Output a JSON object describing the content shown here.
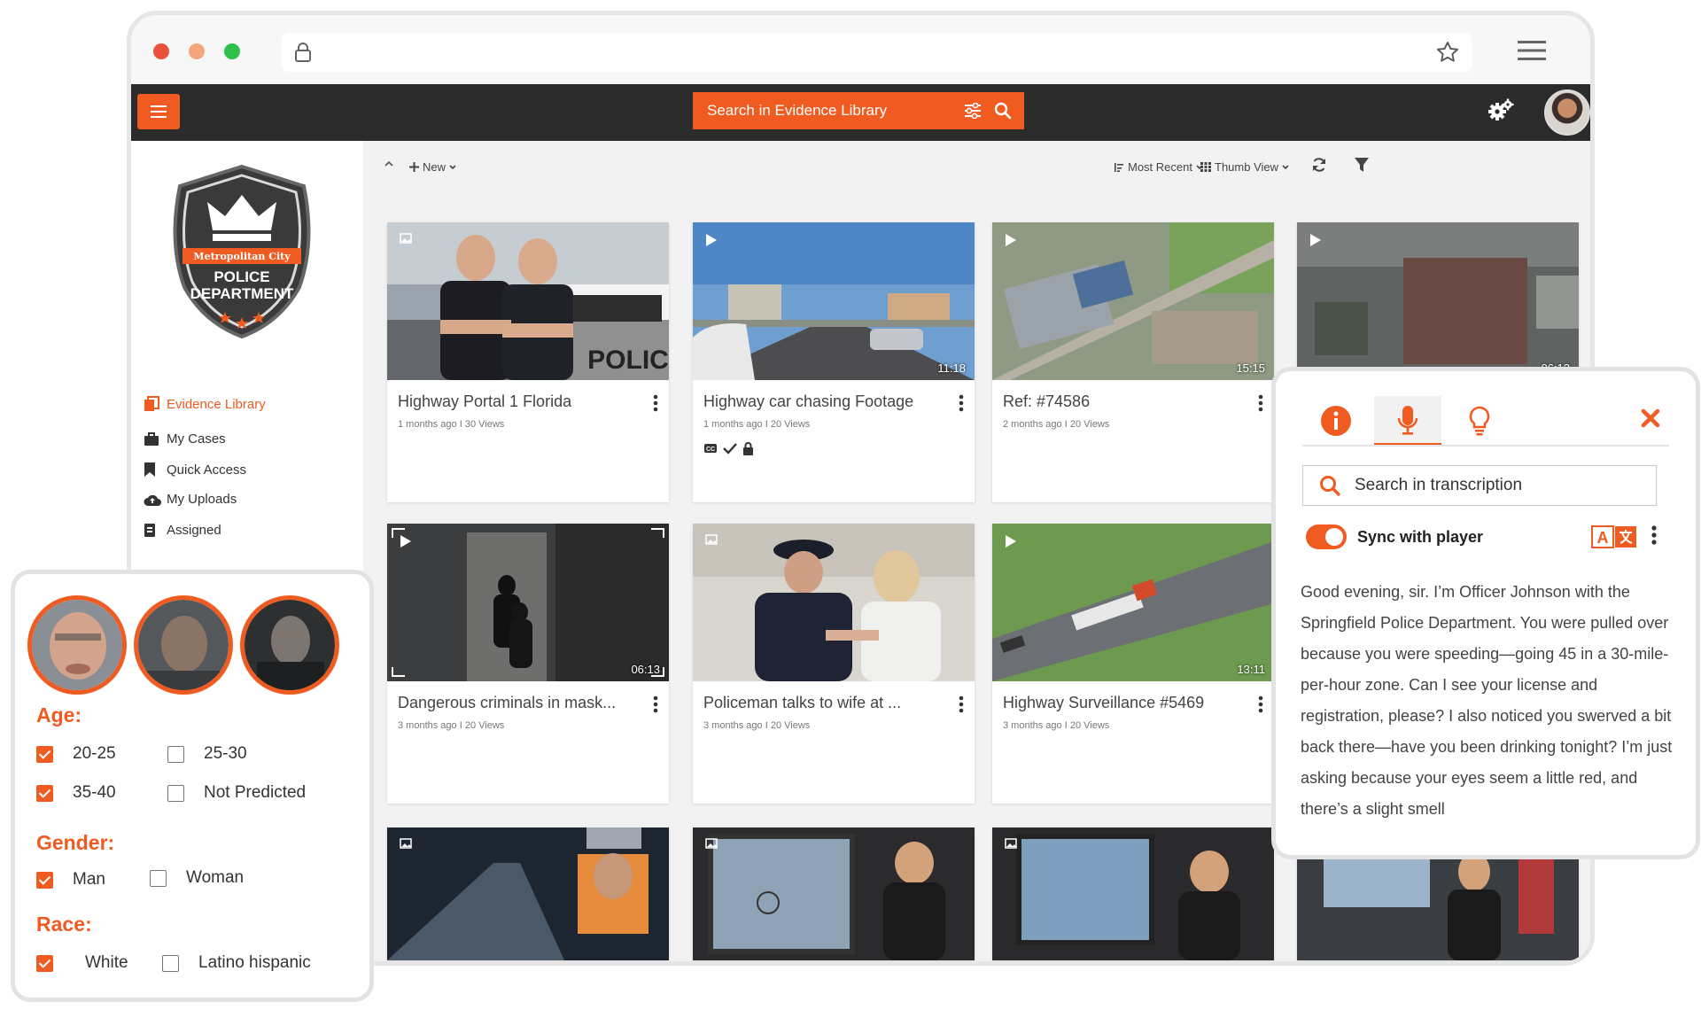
{
  "browser": {
    "menu": "menu-icon"
  },
  "appbar": {
    "search_label": "Search in Evidence Library"
  },
  "badge": {
    "top_text": "Metropolitan City",
    "line1": "POLICE",
    "line2": "DEPARTMENT"
  },
  "sidebar": {
    "items": [
      {
        "label": "Evidence Library",
        "icon": "library-icon",
        "active": true
      },
      {
        "label": "My Cases",
        "icon": "briefcase-icon"
      },
      {
        "label": "Quick Access",
        "icon": "bookmark-icon"
      },
      {
        "label": "My Uploads",
        "icon": "cloud-upload-icon"
      },
      {
        "label": "Assigned",
        "icon": "clipboard-icon"
      }
    ]
  },
  "toolbar": {
    "new_label": "New",
    "sort_label": "Most Recent",
    "view_label": "Thumb View"
  },
  "cards": [
    {
      "title": "Highway Portal 1 Florida",
      "meta": "1 months ago I 30 Views",
      "duration": "",
      "kind": "image",
      "thumb_text": "POLICE"
    },
    {
      "title": "Highway car chasing Footage",
      "meta": "1 months ago I 20 Views",
      "duration": "11:18",
      "kind": "video"
    },
    {
      "title": "Ref: #74586",
      "meta": "2 months ago I 20 Views",
      "duration": "15:15",
      "kind": "video"
    },
    {
      "title": "",
      "meta": "",
      "duration": "06:13",
      "kind": "video"
    },
    {
      "title": "Dangerous criminals in mask...",
      "meta": "3 months ago I 20 Views",
      "duration": "06:13",
      "kind": "video"
    },
    {
      "title": "Policeman talks to wife at ...",
      "meta": "3 months ago I 20 Views",
      "duration": "",
      "kind": "image"
    },
    {
      "title": "Highway Surveillance #5469",
      "meta": "3 months ago I 20 Views",
      "duration": "13:11",
      "kind": "video"
    }
  ],
  "transcript_panel": {
    "search_placeholder": "Search in transcription",
    "sync_label": "Sync with player",
    "text": "Good evening, sir. I’m Officer Johnson with the Springfield Police Department. You were pulled over because you were speeding—going 45 in a 30-mile-per-hour zone. Can I see your license and registration, please? I also noticed you swerved a bit back there—have you been drinking tonight? I’m just asking because your eyes seem a little red, and there’s a slight smell"
  },
  "filters": {
    "age_heading": "Age:",
    "age": [
      {
        "label": "20-25",
        "checked": true
      },
      {
        "label": "25-30",
        "checked": false
      },
      {
        "label": "35-40",
        "checked": true
      },
      {
        "label": "Not Predicted",
        "checked": false
      }
    ],
    "gender_heading": "Gender:",
    "gender": [
      {
        "label": "Man",
        "checked": true
      },
      {
        "label": "Woman",
        "checked": false
      }
    ],
    "race_heading": "Race:",
    "race": [
      {
        "label": "White",
        "checked": true
      },
      {
        "label": "Latino hispanic",
        "checked": false
      }
    ]
  },
  "colors": {
    "accent": "#ef5b21",
    "appbar": "#2b2b2b",
    "content_bg": "#f2f2f2"
  }
}
